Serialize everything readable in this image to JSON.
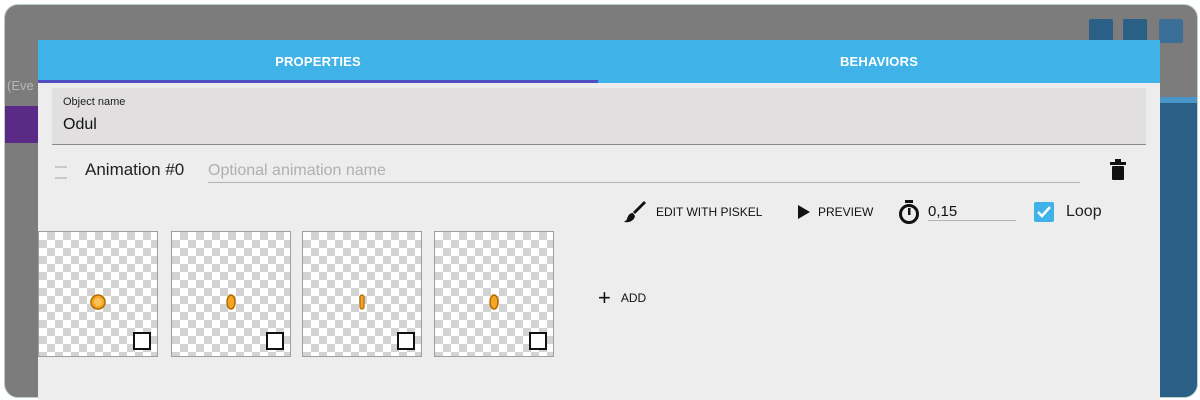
{
  "background": {
    "partial_label": "(Eve"
  },
  "tabs": [
    {
      "label": "PROPERTIES",
      "active": true
    },
    {
      "label": "BEHAVIORS",
      "active": false
    }
  ],
  "object": {
    "name_label": "Object name",
    "name_value": "Odul"
  },
  "animation": {
    "title": "Animation #0",
    "name_placeholder": "Optional animation name",
    "name_value": ""
  },
  "toolbar": {
    "edit_label": "EDIT WITH PISKEL",
    "preview_label": "PREVIEW",
    "timer_value": "0,15",
    "loop_label": "Loop",
    "loop_checked": true
  },
  "frames": [
    {
      "icon": "coin-front-icon"
    },
    {
      "icon": "coin-turning-icon"
    },
    {
      "icon": "coin-edge-icon"
    },
    {
      "icon": "coin-turning-icon"
    }
  ],
  "add_label": "ADD",
  "colors": {
    "accent": "#3fb3e8",
    "tab_indicator": "#4f4fc2",
    "coin": "#f5a623"
  }
}
